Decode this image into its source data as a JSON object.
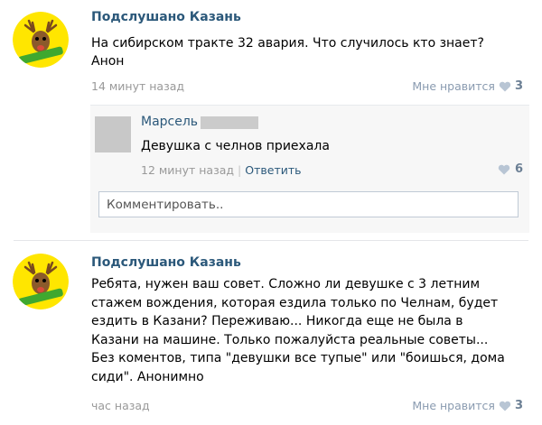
{
  "posts": [
    {
      "author": "Подслушано Казань",
      "text_lines": [
        "На сибирском тракте 32 авария. Что случилось кто знает?",
        "Анон"
      ],
      "time": "14 минут назад",
      "likes_label": "Мне нравится",
      "likes_count": "3",
      "replies": [
        {
          "author": "Марсель",
          "text": "Девушка с челнов приехала",
          "time": "12 минут назад",
          "reply_label": "Ответить",
          "likes_count": "6"
        }
      ],
      "comment_placeholder": "Комментировать.."
    },
    {
      "author": "Подслушано Казань",
      "text_lines": [
        "Ребята, нужен ваш совет. Сложно ли девушке с 3 летним",
        "стажем вождения, которая ездила только по Челнам, будет",
        "ездить в Казани? Переживаю... Никогда еще не была в",
        "Казани на машине. Только пожалуйста реальные советы...",
        "Без коментов, типа \"девушки все тупые\" или \"боишься, дома",
        "сиди\". Анонимно"
      ],
      "time": "час назад",
      "likes_label": "Мне нравится",
      "likes_count": "3"
    }
  ],
  "colors": {
    "link": "#2b587a",
    "meta": "#999999",
    "likes": "#8a9bb0",
    "reply_bg": "#f7f7f7",
    "avatar_bg": "#ffe600",
    "avatar_banner": "#3fa82f"
  },
  "icons": {
    "avatar": "deer-logo-icon",
    "like": "heart-icon"
  }
}
